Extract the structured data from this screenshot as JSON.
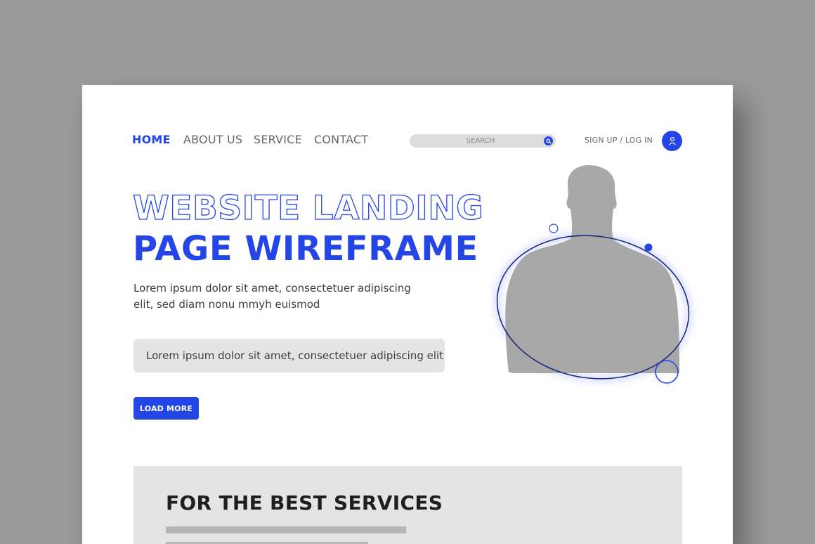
{
  "nav": {
    "items": [
      {
        "label": "HOME",
        "active": true
      },
      {
        "label": "ABOUT US",
        "active": false
      },
      {
        "label": "SERVICE",
        "active": false
      },
      {
        "label": "CONTACT",
        "active": false
      }
    ]
  },
  "search": {
    "placeholder": "SEARCH",
    "icon": "search-icon"
  },
  "auth": {
    "label": "SIGN UP / LOG IN",
    "icon": "user-icon"
  },
  "hero": {
    "title_line1": "WEBSITE LANDING",
    "title_line2": "PAGE WIREFRAME",
    "description": "Lorem ipsum dolor sit amet, consectetuer adipiscing elit, sed diam nonu mmyh euismod",
    "field_text": "Lorem ipsum dolor sit amet, consectetuer adipiscing elit",
    "button_label": "LOAD MORE"
  },
  "services": {
    "title": "FOR THE BEST SERVICES"
  },
  "colors": {
    "accent": "#2546e6",
    "background": "#9b9b9b",
    "panel": "#e4e4e4",
    "silhouette": "#a8a8a8"
  }
}
